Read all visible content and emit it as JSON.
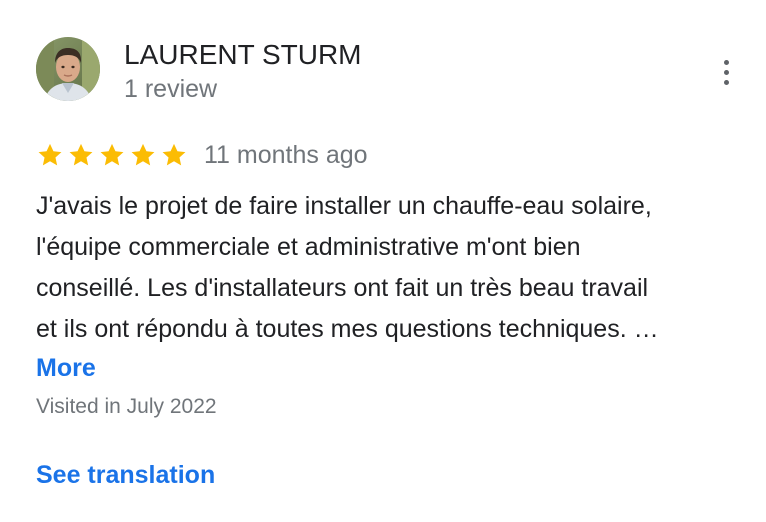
{
  "reviewer": {
    "name": "LAURENT STURM",
    "review_count": "1 review",
    "avatar": "reviewer-avatar-photo"
  },
  "menu": {
    "icon": "more-vert-icon"
  },
  "rating": {
    "stars": 5,
    "max_stars": 5,
    "star_color": "#fbbc04",
    "date": "11 months ago"
  },
  "review": {
    "lines": [
      "J'avais le projet de faire installer un chauffe-eau solaire,",
      "l'équipe commerciale et administrative m'ont bien",
      "conseillé. Les d'installateurs ont fait un très beau travail",
      "et ils ont répondu à toutes mes questions techniques. …"
    ],
    "more_label": "More"
  },
  "visited": "Visited in July 2022",
  "translation": {
    "label": "See translation"
  },
  "colors": {
    "link": "#1a73e8",
    "text": "#202124",
    "secondary": "#70757a"
  }
}
